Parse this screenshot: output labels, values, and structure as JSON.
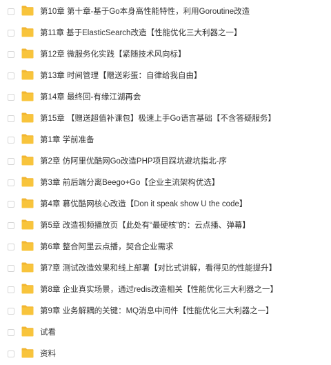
{
  "colors": {
    "folder": "#f8c43c",
    "folder_tab": "#f2b632",
    "text": "#333333",
    "checkbox_border": "#d6d6d6"
  },
  "icons": {
    "checkbox": "checkbox-icon",
    "folder": "folder-icon"
  },
  "items": [
    {
      "name": "第10章 第十章-基于Go本身高性能特性，利用Goroutine改造"
    },
    {
      "name": "第11章 基于ElasticSearch改造【性能优化三大利器之一】"
    },
    {
      "name": "第12章 微服务化实践【紧随技术风向标】"
    },
    {
      "name": "第13章 时间管理【赠送彩蛋：自律给我自由】"
    },
    {
      "name": "第14章 最终回-有缘江湖再会"
    },
    {
      "name": "第15章 【赠送超值补课包】极速上手Go语言基础【不含答疑服务】"
    },
    {
      "name": "第1章 学前准备"
    },
    {
      "name": "第2章 仿阿里优酷网Go改造PHP项目踩坑避坑指北-序"
    },
    {
      "name": "第3章 前后端分离Beego+Go【企业主流架构优选】"
    },
    {
      "name": "第4章 慕优酷网核心改造【Don it speak show U the code】"
    },
    {
      "name": "第5章 改造视频播放页【此处有“最硬核”的：云点播、弹幕】"
    },
    {
      "name": "第6章 整合阿里云点播，契合企业需求"
    },
    {
      "name": "第7章 测试改造效果和线上部署【对比式讲解，看得见的性能提升】"
    },
    {
      "name": "第8章 企业真实场景，通过redis改造相关【性能优化三大利器之一】"
    },
    {
      "name": "第9章 业务解耦的关键：MQ消息中间件【性能优化三大利器之一】"
    },
    {
      "name": "试看"
    },
    {
      "name": "资料"
    }
  ]
}
